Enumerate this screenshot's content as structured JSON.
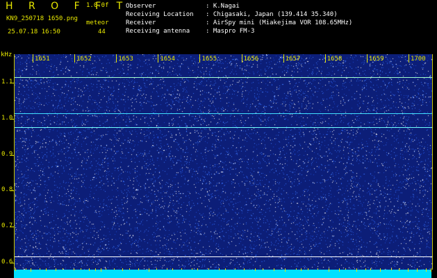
{
  "header": {
    "title": "H R O F F T",
    "version": "1.0.0f",
    "filename": "KN9_250718 1650.png",
    "datetime": "25.07.18 16:50",
    "meteor_label": "meteor",
    "meteor_count": "44",
    "fields": [
      {
        "label": "Observer",
        "value": ": K.Nagai"
      },
      {
        "label": "Receiving Location",
        "value": ": Chigasaki, Japan (139.414 35.340)"
      },
      {
        "label": "Receiver",
        "value": ": AirSpy mini (Miakejima VOR 108.65MHz)"
      },
      {
        "label": "Receiving antenna",
        "value": ": Maspro FM-3"
      }
    ]
  },
  "chart_data": {
    "type": "heatmap",
    "ylabel": "kHz",
    "x_ticks": [
      "1651",
      "1652",
      "1653",
      "1654",
      "1655",
      "1656",
      "1657",
      "1658",
      "1659",
      "1700"
    ],
    "y_ticks": [
      "1.1",
      "1.0",
      "0.9",
      "0.8",
      "0.7",
      "0.6"
    ],
    "ylim": [
      0.58,
      1.18
    ],
    "signal_lines": [
      {
        "freq": 1.117,
        "color": "#a0ffd0"
      },
      {
        "freq": 1.016,
        "color": "#40e0ff"
      },
      {
        "freq": 0.977,
        "color": "#70ffff"
      },
      {
        "freq": 0.617,
        "color": "#ffffff"
      }
    ],
    "colors": {
      "background": "#0c1e78",
      "axis": "#e8e800",
      "bottom_band": "#00e0ff"
    }
  }
}
